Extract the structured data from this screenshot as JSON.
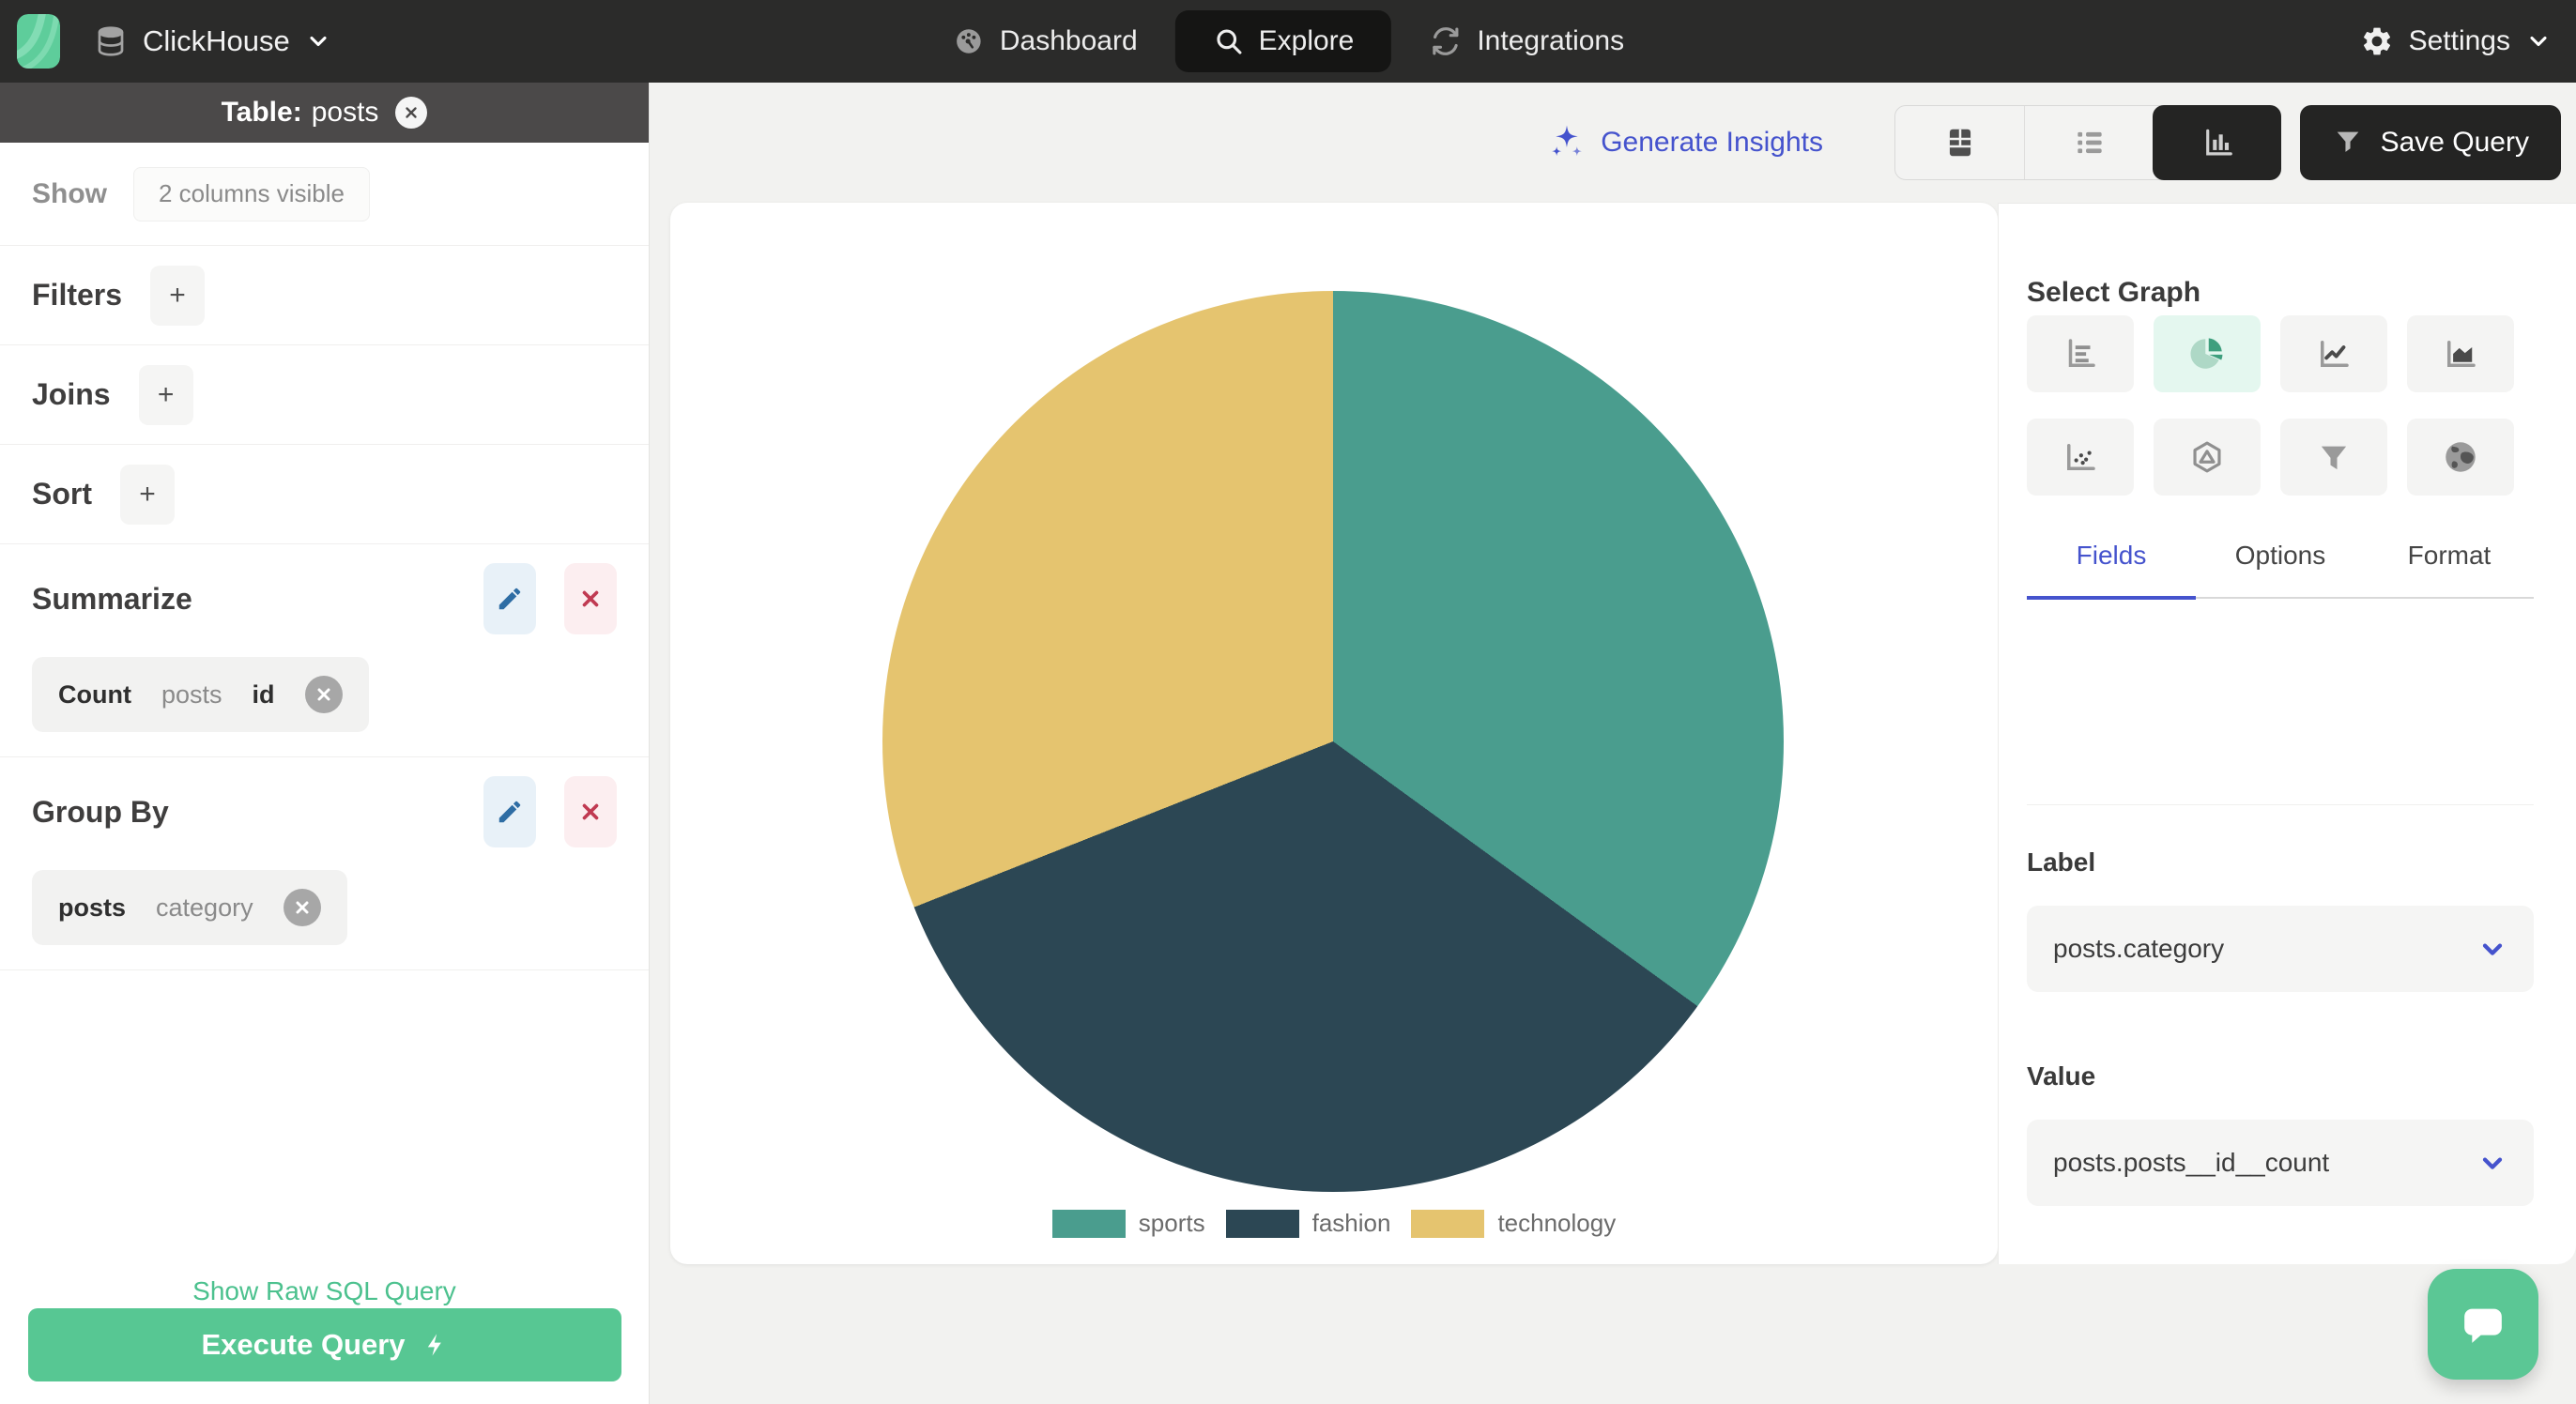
{
  "navbar": {
    "brand": "ClickHouse",
    "items": [
      "Dashboard",
      "Explore",
      "Integrations"
    ],
    "active_item": "Explore",
    "settings": "Settings"
  },
  "sidebar": {
    "header": {
      "prefix": "Table:",
      "table": "posts"
    },
    "show_label": "Show",
    "show_value": "2 columns visible",
    "filters_label": "Filters",
    "joins_label": "Joins",
    "sort_label": "Sort",
    "add_button": "+",
    "summarize": {
      "heading": "Summarize",
      "chip": {
        "agg": "Count",
        "table": "posts",
        "field": "id"
      }
    },
    "group_by": {
      "heading": "Group By",
      "chip": {
        "table": "posts",
        "field": "category"
      }
    },
    "raw_sql_link": "Show Raw SQL Query",
    "execute_button": "Execute Query"
  },
  "toolbar": {
    "generate_insights": "Generate Insights",
    "save_query": "Save Query"
  },
  "graph_panel": {
    "title": "Select Graph",
    "graph_types": [
      "bar",
      "pie",
      "line",
      "area",
      "scatter",
      "radar",
      "funnel",
      "geo"
    ],
    "selected_graph": "pie",
    "tabs": [
      "Fields",
      "Options",
      "Format"
    ],
    "active_tab": "Fields",
    "label_heading": "Label",
    "label_value": "posts.category",
    "value_heading": "Value",
    "value_value": "posts.posts__id__count"
  },
  "chart_data": {
    "type": "pie",
    "categories": [
      "sports",
      "fashion",
      "technology"
    ],
    "values": [
      35,
      34,
      31
    ],
    "colors": [
      "#4a9d8e",
      "#2c4754",
      "#e5c46f"
    ],
    "title": "",
    "legend_position": "bottom"
  },
  "theme": {
    "accent_green": "#57c793",
    "link_green": "#4cc18e",
    "accent_blue": "#4553cd",
    "navbar_bg": "#2b2b2a",
    "selected_mint": "#e4f7ef",
    "dark_button": "#242423"
  }
}
